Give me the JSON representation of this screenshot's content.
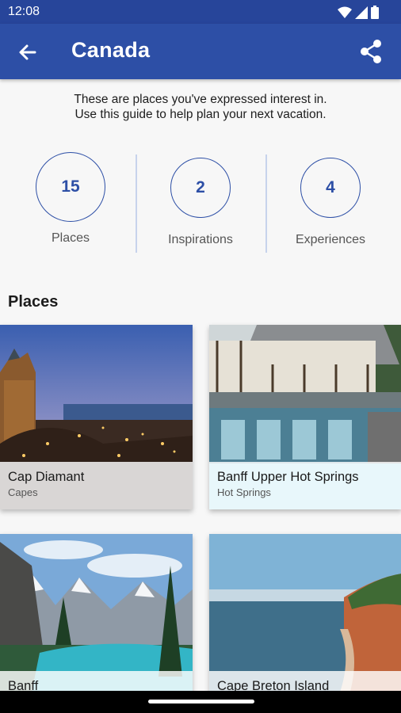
{
  "status": {
    "time": "12:08"
  },
  "header": {
    "title": "Canada"
  },
  "intro": {
    "line1": "These are places you've expressed interest in.",
    "line2": "Use this guide to help plan your next vacation."
  },
  "stats": [
    {
      "value": "15",
      "label": "Places"
    },
    {
      "value": "2",
      "label": "Inspirations"
    },
    {
      "value": "4",
      "label": "Experiences"
    }
  ],
  "places_section": {
    "title": "Places",
    "cards": [
      {
        "name": "Cap Diamant",
        "type": "Capes"
      },
      {
        "name": "Banff Upper Hot Springs",
        "type": "Hot Springs"
      },
      {
        "name": "Banff",
        "type": ""
      },
      {
        "name": "Cape Breton Island",
        "type": ""
      }
    ]
  }
}
